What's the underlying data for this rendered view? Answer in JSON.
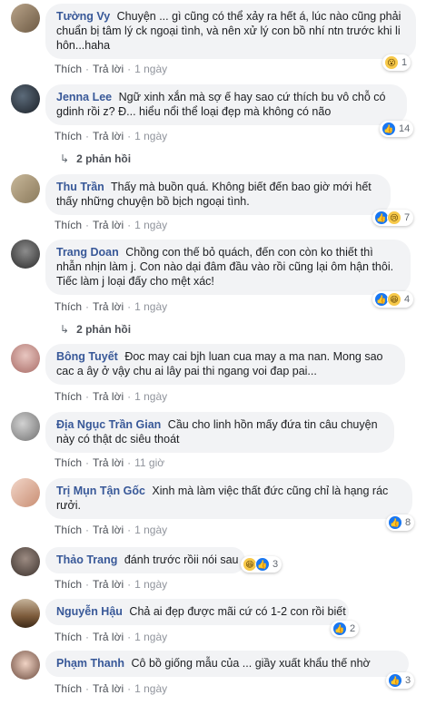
{
  "actions": {
    "like": "Thích",
    "reply": "Trả lời"
  },
  "comments": [
    {
      "author": "Tường Vy",
      "text": "Chuyện ... gì cũng có thể xảy ra hết á, lúc nào cũng phải chuẩn bị tâm lý ck ngoại tình, và nên xử lý con bồ nhí ntn trước khi li hôn...haha",
      "time": "1 ngày",
      "reaction": {
        "icons": [
          "wow-icon"
        ],
        "count": "1"
      }
    },
    {
      "author": "Jenna Lee",
      "text": "Ngữ xinh xắn mà sợ ế hay sao cứ thích bu vô chỗ có gdinh rồi z? Đ... hiểu nổi thể loại đẹp mà không có não",
      "time": "1 ngày",
      "reaction": {
        "icons": [
          "like-icon"
        ],
        "count": "14"
      },
      "replies": "2 phản hồi"
    },
    {
      "author": "Thu Trần",
      "text": "Thấy mà buồn quá. Không biết đến bao giờ mới hết thấy những chuyện bồ bịch ngoại tình.",
      "time": "1 ngày",
      "reaction": {
        "icons": [
          "like-icon",
          "sad-icon"
        ],
        "count": "7"
      }
    },
    {
      "author": "Trang Doan",
      "text": "Chồng con thế bỏ quách, đến con còn ko thiết thì nhẫn nhịn làm j. Con nào dại đâm đầu vào rồi cũng lại ôm hận thôi. Tiếc làm j loại đấy cho mệt xác!",
      "time": "1 ngày",
      "reaction": {
        "icons": [
          "like-icon",
          "haha-icon"
        ],
        "count": "4"
      },
      "replies": "2 phản hồi"
    },
    {
      "author": "Bông Tuyết",
      "text": "Đoc may cai bjh luan cua may a ma nan. Mong sao cac a ây ở vậy chu ai lây pai thi ngang voi đap pai...",
      "time": "1 ngày"
    },
    {
      "author": "Địa Ngục Trần Gian",
      "text": "Cầu cho linh hồn mấy đứa tin câu chuyện này có thật dc siêu thoát",
      "time": "11 giờ"
    },
    {
      "author": "Trị Mụn Tận Gốc",
      "text": "Xinh mà làm việc thất đức cũng chỉ là hạng rác rưởi.",
      "time": "1 ngày",
      "reaction": {
        "icons": [
          "like-icon"
        ],
        "count": "8"
      }
    },
    {
      "author": "Thảo Trang",
      "text": "đánh trước rồii nói sau",
      "time": "1 ngày",
      "reaction": {
        "icons": [
          "haha-icon",
          "like-icon"
        ],
        "count": "3"
      }
    },
    {
      "author": "Nguyễn Hậu",
      "text": "Chả ai đẹp được mãi cứ có 1-2 con rồi biết",
      "time": "1 ngày",
      "reaction": {
        "icons": [
          "like-icon"
        ],
        "count": "2"
      }
    },
    {
      "author": "Phạm Thanh",
      "text": "Cô bồ giống mẫu của ... giầy xuất khẩu thế nhờ",
      "time": "1 ngày",
      "reaction": {
        "icons": [
          "like-icon"
        ],
        "count": "3"
      }
    }
  ]
}
